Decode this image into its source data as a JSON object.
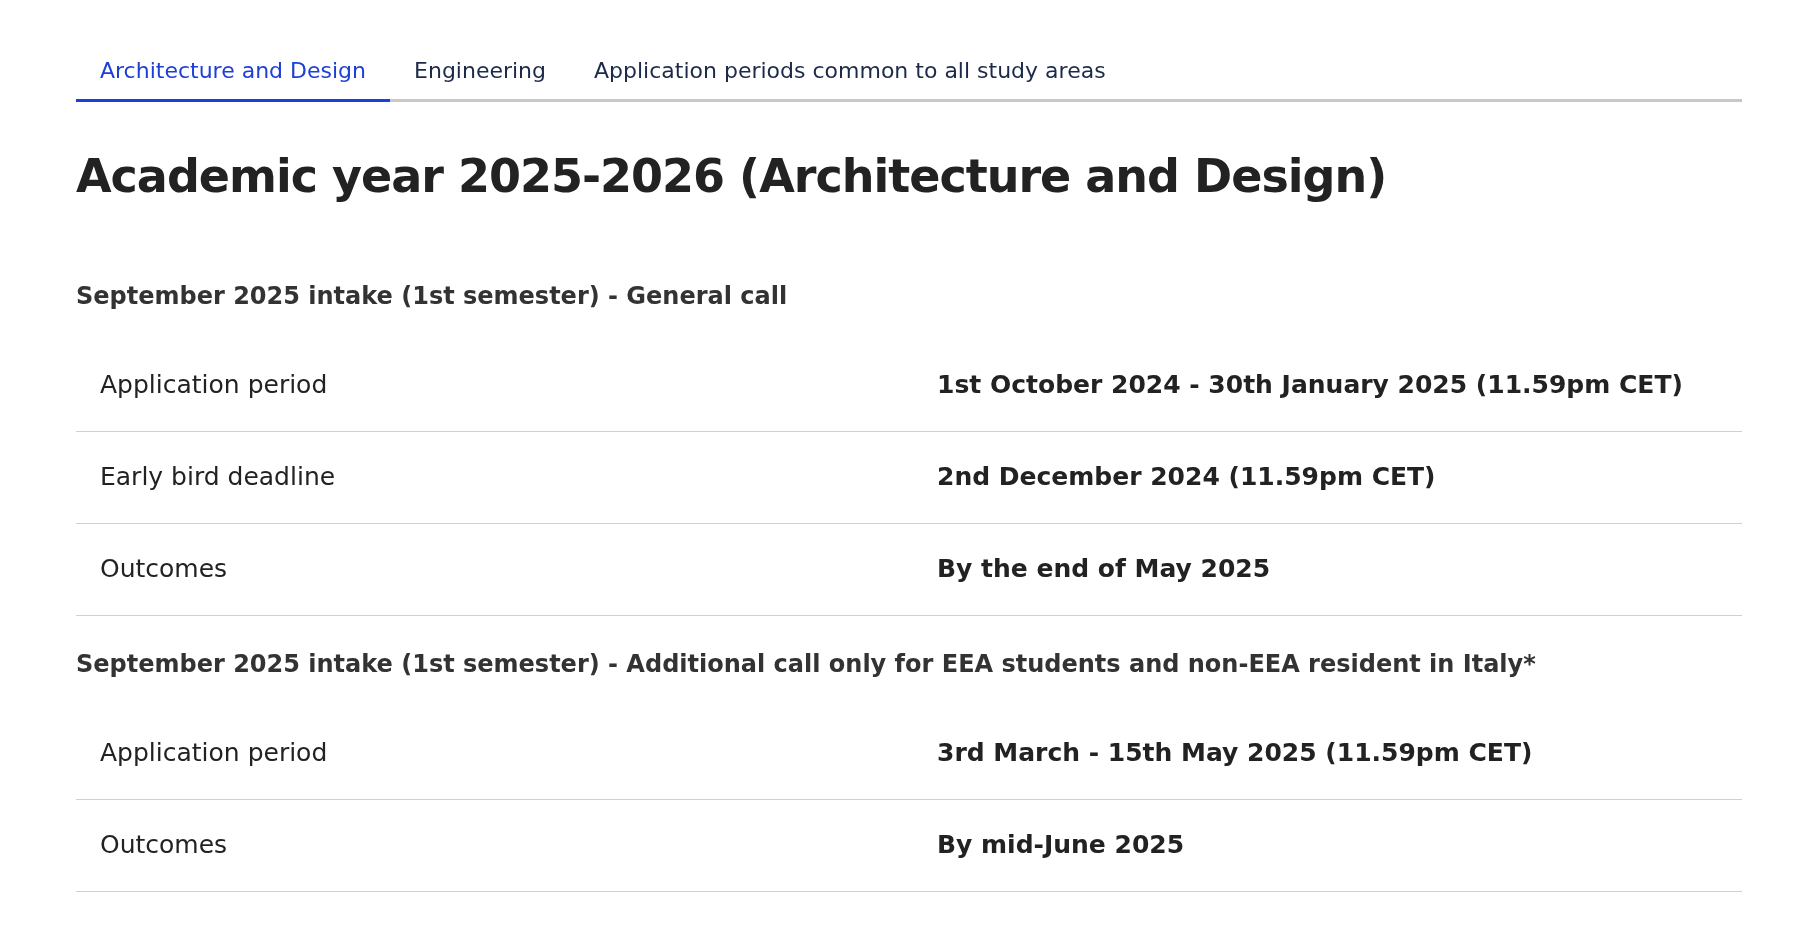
{
  "tabs": [
    {
      "label": "Architecture and Design",
      "selected": true
    },
    {
      "label": "Engineering",
      "selected": false
    },
    {
      "label": "Application periods common to all study areas",
      "selected": false
    }
  ],
  "title": "Academic year 2025-2026 (Architecture and Design)",
  "sections": [
    {
      "heading": "September 2025 intake (1st semester) - General call",
      "rows": [
        {
          "label": "Application period",
          "value": "1st October 2024 - 30th January 2025 (11.59pm CET)"
        },
        {
          "label": "Early bird deadline",
          "value": "2nd December 2024 (11.59pm CET)"
        },
        {
          "label": "Outcomes",
          "value": "By the end of May 2025"
        }
      ]
    },
    {
      "heading": "September 2025 intake (1st semester) - Additional call only for EEA students and non-EEA resident in Italy*",
      "rows": [
        {
          "label": "Application period",
          "value": "3rd March - 15th May 2025 (11.59pm CET)"
        },
        {
          "label": "Outcomes",
          "value": "By mid-June 2025"
        }
      ]
    }
  ]
}
